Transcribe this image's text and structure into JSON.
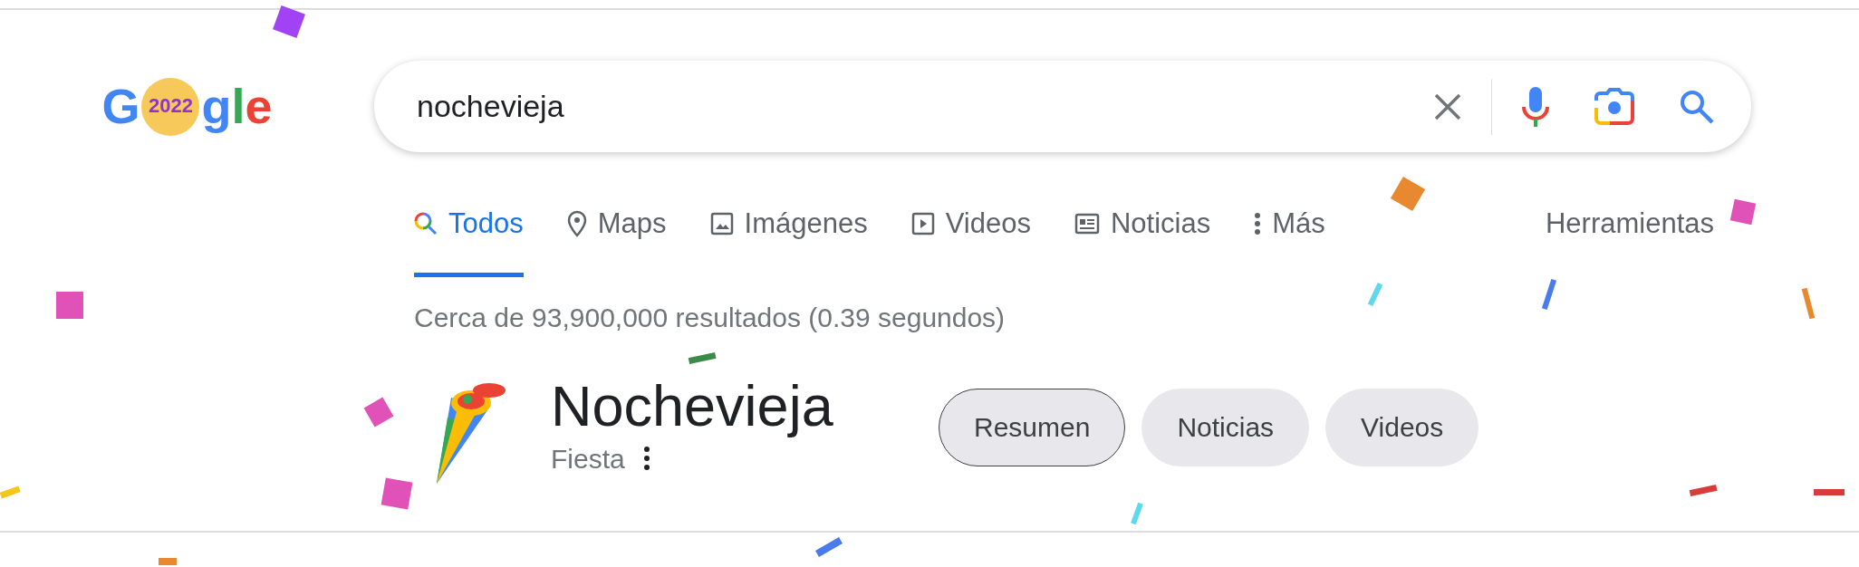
{
  "logo": {
    "letters": [
      {
        "char": "G",
        "color": "#4285f4"
      },
      {
        "char": "g",
        "color": "#4285f4"
      },
      {
        "char": "l",
        "color": "#34a853"
      },
      {
        "char": "e",
        "color": "#ea4335"
      }
    ],
    "badge": "2022"
  },
  "search": {
    "value": "nochevieja"
  },
  "tabs": [
    {
      "label": "Todos",
      "kind": "search",
      "selected": true
    },
    {
      "label": "Maps",
      "kind": "pin",
      "selected": false
    },
    {
      "label": "Imágenes",
      "kind": "image",
      "selected": false
    },
    {
      "label": "Videos",
      "kind": "play",
      "selected": false
    },
    {
      "label": "Noticias",
      "kind": "news",
      "selected": false
    },
    {
      "label": "Más",
      "kind": "more",
      "selected": false
    }
  ],
  "tools": "Herramientas",
  "result_stats": "Cerca de 93,900,000 resultados (0.39 segundos)",
  "entity": {
    "title": "Nochevieja",
    "subtitle": "Fiesta",
    "chips": [
      {
        "label": "Resumen",
        "selected": true
      },
      {
        "label": "Noticias",
        "selected": false
      },
      {
        "label": "Videos",
        "selected": false
      }
    ]
  }
}
